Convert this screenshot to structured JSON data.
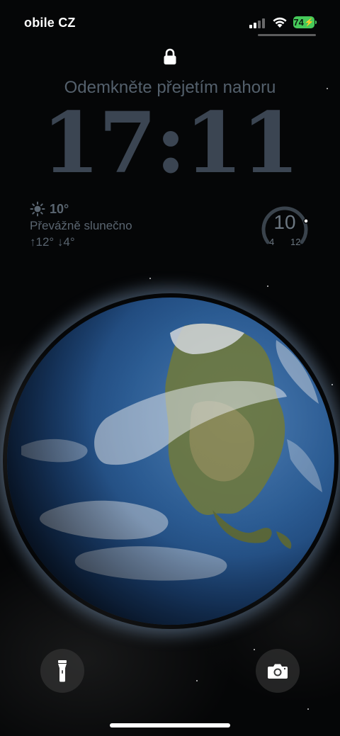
{
  "status_bar": {
    "carrier": "obile CZ",
    "battery": "74",
    "signal_icon": "signal-bars-icon",
    "wifi_icon": "wifi-icon",
    "battery_color": "#46c95a"
  },
  "lock_screen": {
    "lock_icon": "lock-icon",
    "unlock_hint": "Odemkněte přejetím nahoru",
    "time": "17:11"
  },
  "weather_widget": {
    "icon": "sun-icon",
    "temperature": "10°",
    "condition": "Převážně slunečno",
    "range": "↑12° ↓4°"
  },
  "temperature_gauge": {
    "current": "10",
    "min": "4",
    "max": "12"
  },
  "wallpaper": {
    "subject": "earth-globe"
  },
  "quick_actions": {
    "flashlight_icon": "flashlight-icon",
    "camera_icon": "camera-icon"
  },
  "colors": {
    "clock": "#3b4552",
    "hint": "#54606c",
    "widget": "#5a6570"
  }
}
